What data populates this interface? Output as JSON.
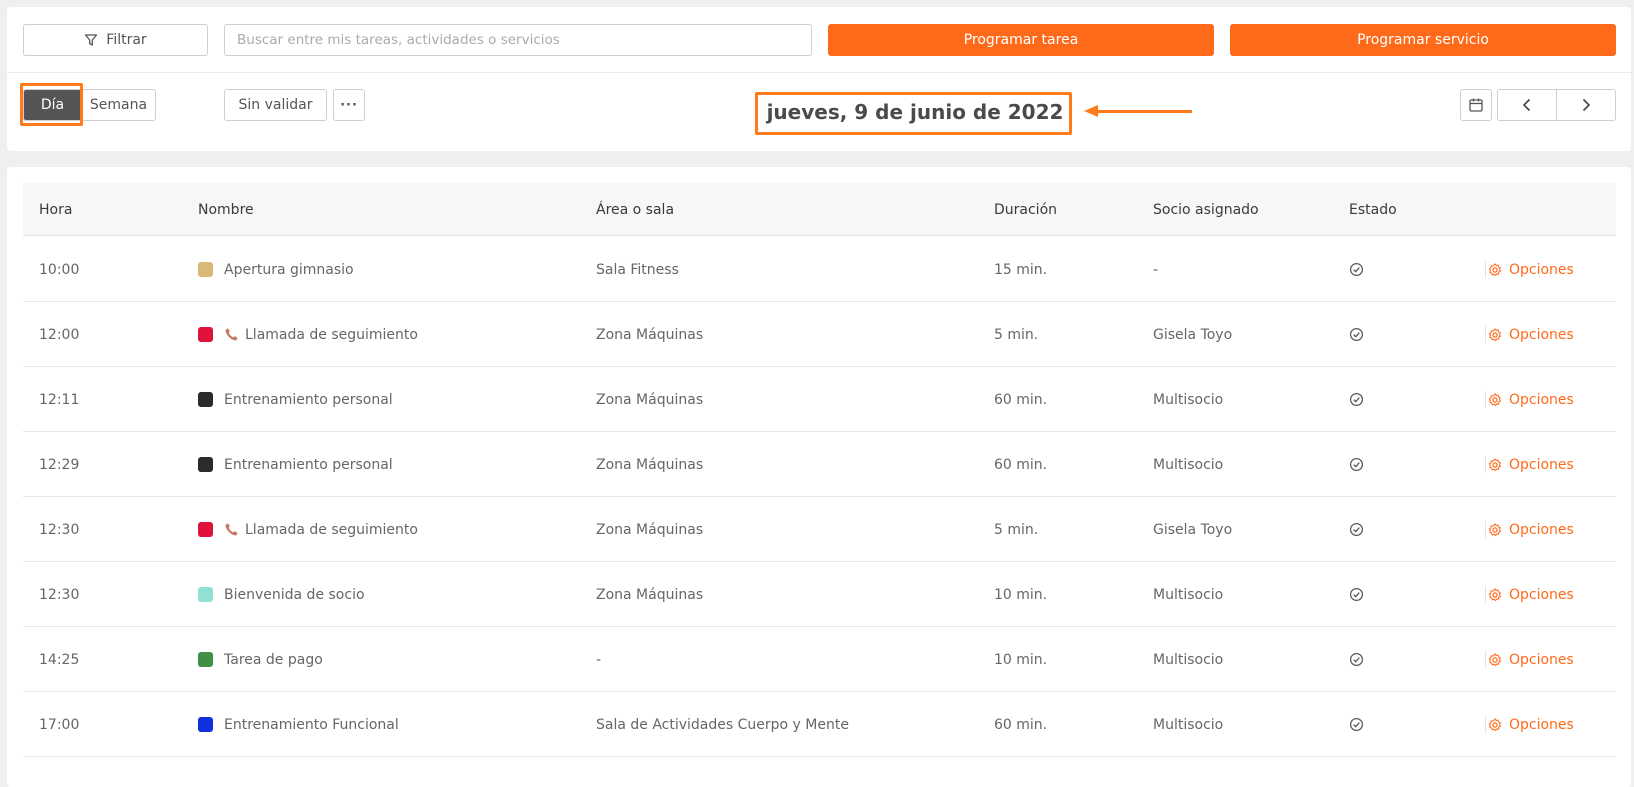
{
  "toolbar": {
    "filter_label": "Filtrar",
    "search_placeholder": "Buscar entre mis tareas, actividades o servicios",
    "schedule_task_label": "Programar tarea",
    "schedule_service_label": "Programar servicio"
  },
  "view": {
    "day_label": "Día",
    "week_label": "Semana",
    "unvalidated_label": "Sin validar",
    "more_label": "···",
    "current_date": "jueves, 9 de junio de 2022"
  },
  "colors": {
    "accent": "#ff6a1a",
    "highlight": "#ff7a1a"
  },
  "table": {
    "headers": {
      "hora": "Hora",
      "nombre": "Nombre",
      "area": "Área o sala",
      "duracion": "Duración",
      "socio": "Socio asignado",
      "estado": "Estado"
    },
    "options_label": "Opciones",
    "rows": [
      {
        "time": "10:00",
        "name": "Apertura gimnasio",
        "color": "#d9b878",
        "phone": false,
        "area": "Sala Fitness",
        "duration": "15 min.",
        "member": "-"
      },
      {
        "time": "12:00",
        "name": "Llamada de seguimiento",
        "color": "#e0123a",
        "phone": true,
        "area": "Zona Máquinas",
        "duration": "5 min.",
        "member": "Gisela Toyo"
      },
      {
        "time": "12:11",
        "name": "Entrenamiento personal",
        "color": "#2b2b2b",
        "phone": false,
        "area": "Zona Máquinas",
        "duration": "60 min.",
        "member": "Multisocio"
      },
      {
        "time": "12:29",
        "name": "Entrenamiento personal",
        "color": "#2b2b2b",
        "phone": false,
        "area": "Zona Máquinas",
        "duration": "60 min.",
        "member": "Multisocio"
      },
      {
        "time": "12:30",
        "name": "Llamada de seguimiento",
        "color": "#e0123a",
        "phone": true,
        "area": "Zona Máquinas",
        "duration": "5 min.",
        "member": "Gisela Toyo"
      },
      {
        "time": "12:30",
        "name": "Bienvenida de socio",
        "color": "#90e0d6",
        "phone": false,
        "area": "Zona Máquinas",
        "duration": "10 min.",
        "member": "Multisocio"
      },
      {
        "time": "14:25",
        "name": "Tarea de pago",
        "color": "#3f8f45",
        "phone": false,
        "area": "-",
        "duration": "10 min.",
        "member": "Multisocio"
      },
      {
        "time": "17:00",
        "name": "Entrenamiento Funcional",
        "color": "#1030e0",
        "phone": false,
        "area": "Sala de Actividades Cuerpo y Mente",
        "duration": "60 min.",
        "member": "Multisocio"
      }
    ]
  }
}
